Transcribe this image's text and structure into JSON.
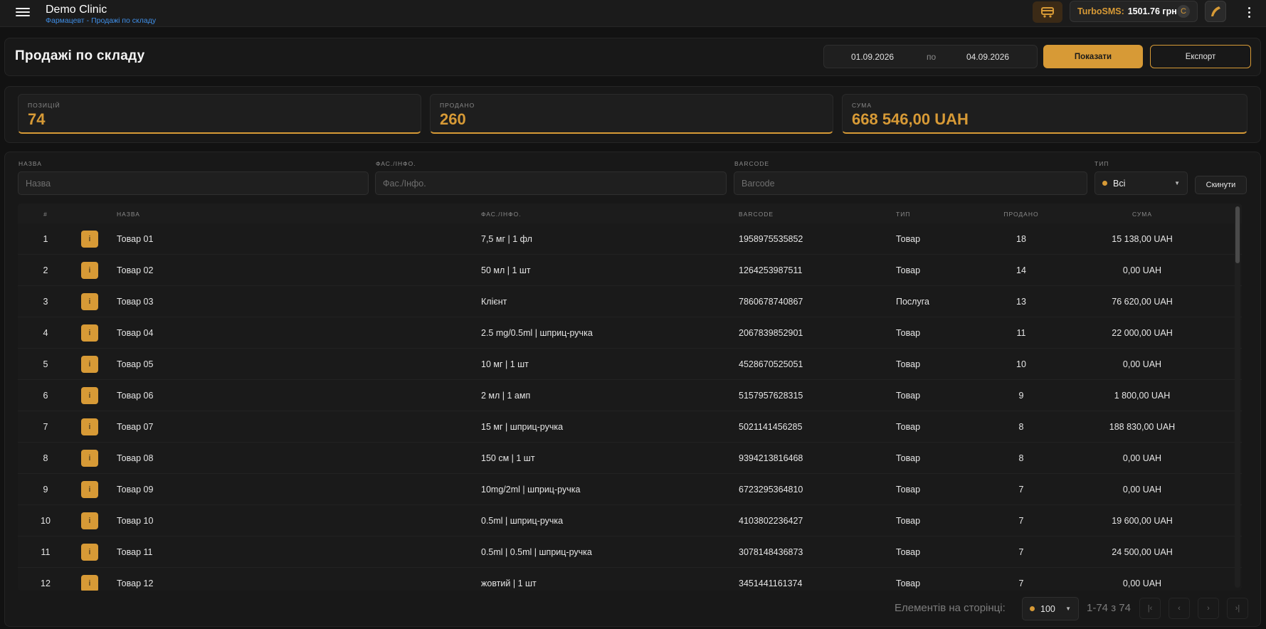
{
  "header": {
    "app_title": "Demo Clinic",
    "breadcrumb_section": "Фармацевт",
    "breadcrumb_sep": "-",
    "breadcrumb_page": "Продажі по складу",
    "sms_label": "TurboSMS:",
    "sms_balance": "1501.76 грн",
    "sms_currency_badge": "C",
    "icons": [
      "menu-icon",
      "cart-icon",
      "phone-icon",
      "more-vertical-icon"
    ],
    "accent_color": "#d79a36",
    "link_color": "#3f8ee6"
  },
  "page": {
    "title": "Продажі по складу",
    "date_from": "01.09.2026",
    "date_sep": "по",
    "date_to": "04.09.2026",
    "show_label": "Показати",
    "export_label": "Експорт"
  },
  "stats": [
    {
      "label": "ПОЗИЦІЙ",
      "value": "74"
    },
    {
      "label": "ПРОДАНО",
      "value": "260"
    },
    {
      "label": "СУМА",
      "value": "668 546,00 UAH"
    }
  ],
  "filters": {
    "name_label": "НАЗВА",
    "name_placeholder": "Назва",
    "pack_label": "ФАС./ІНФО.",
    "pack_placeholder": "Фас./Інфо.",
    "barcode_label": "BARCODE",
    "barcode_placeholder": "Barcode",
    "type_label": "ТИП",
    "type_value": "Всі",
    "reset_label": "Скинути"
  },
  "table": {
    "headers": {
      "num": "#",
      "name": "НАЗВА",
      "pack": "ФАС./ІНФО.",
      "barcode": "BARCODE",
      "type": "ТИП",
      "sold": "ПРОДАНО",
      "sum": "СУМА"
    },
    "info_glyph": "i",
    "rows": [
      {
        "num": "1",
        "name": "Товар 01",
        "pack": "7,5 мг | 1 фл",
        "barcode": "1958975535852",
        "type": "Товар",
        "sold": "18",
        "sum": "15 138,00 UAH"
      },
      {
        "num": "2",
        "name": "Товар 02",
        "pack": "50 мл | 1 шт",
        "barcode": "1264253987511",
        "type": "Товар",
        "sold": "14",
        "sum": "0,00 UAH"
      },
      {
        "num": "3",
        "name": "Товар 03",
        "pack": "Клієнт",
        "barcode": "7860678740867",
        "type": "Послуга",
        "sold": "13",
        "sum": "76 620,00 UAH"
      },
      {
        "num": "4",
        "name": "Товар 04",
        "pack": "2.5 mg/0.5ml | шприц-ручка",
        "barcode": "2067839852901",
        "type": "Товар",
        "sold": "11",
        "sum": "22 000,00 UAH"
      },
      {
        "num": "5",
        "name": "Товар 05",
        "pack": "10 мг | 1 шт",
        "barcode": "4528670525051",
        "type": "Товар",
        "sold": "10",
        "sum": "0,00 UAH"
      },
      {
        "num": "6",
        "name": "Товар 06",
        "pack": "2 мл | 1 амп",
        "barcode": "5157957628315",
        "type": "Товар",
        "sold": "9",
        "sum": "1 800,00 UAH"
      },
      {
        "num": "7",
        "name": "Товар 07",
        "pack": "15 мг | шприц-ручка",
        "barcode": "5021141456285",
        "type": "Товар",
        "sold": "8",
        "sum": "188 830,00 UAH"
      },
      {
        "num": "8",
        "name": "Товар 08",
        "pack": "150 см | 1 шт",
        "barcode": "9394213816468",
        "type": "Товар",
        "sold": "8",
        "sum": "0,00 UAH"
      },
      {
        "num": "9",
        "name": "Товар 09",
        "pack": "10mg/2ml | шприц-ручка",
        "barcode": "6723295364810",
        "type": "Товар",
        "sold": "7",
        "sum": "0,00 UAH"
      },
      {
        "num": "10",
        "name": "Товар 10",
        "pack": "0.5ml | шприц-ручка",
        "barcode": "4103802236427",
        "type": "Товар",
        "sold": "7",
        "sum": "19 600,00 UAH"
      },
      {
        "num": "11",
        "name": "Товар 11",
        "pack": "0.5ml | 0.5ml | шприц-ручка",
        "barcode": "3078148436873",
        "type": "Товар",
        "sold": "7",
        "sum": "24 500,00 UAH"
      },
      {
        "num": "12",
        "name": "Товар 12",
        "pack": "жовтий | 1 шт",
        "barcode": "3451441161374",
        "type": "Товар",
        "sold": "7",
        "sum": "0,00 UAH"
      }
    ]
  },
  "pager": {
    "per_page_label": "Елементів на сторінці:",
    "per_page_value": "100",
    "range": "1-74 з 74",
    "first_glyph": "|‹",
    "prev_glyph": "‹",
    "next_glyph": "›",
    "last_glyph": "›|"
  }
}
